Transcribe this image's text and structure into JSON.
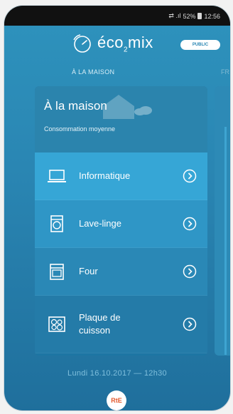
{
  "status_bar": {
    "signal_text": "⇄ .ıl",
    "battery_percent": "52%",
    "time": "12:56"
  },
  "header": {
    "app_name": "éco2mix",
    "logo_prefix": "éco",
    "logo_sub": "2",
    "logo_suffix": "mix",
    "badge": "PUBLIC",
    "active_tab": "À LA MAISON",
    "next_tab": "FR"
  },
  "card": {
    "title": "À la maison",
    "subtitle": "Consommation moyenne",
    "items": [
      {
        "label": "Informatique",
        "icon": "laptop-icon"
      },
      {
        "label": "Lave-linge",
        "icon": "washing-machine-icon"
      },
      {
        "label": "Four",
        "icon": "oven-icon"
      },
      {
        "label_line1": "Plaque de",
        "label_line2": "cuisson",
        "icon": "cooktop-icon"
      }
    ]
  },
  "footer": {
    "datetime": "Lundi 16.10.2017 — 12h30",
    "rte_label": "RtE"
  },
  "colors": {
    "background": "#2a86b3",
    "card_head": "#2b84ad",
    "row_highlight": "#36a6d6",
    "rte": "#e35b2f"
  }
}
